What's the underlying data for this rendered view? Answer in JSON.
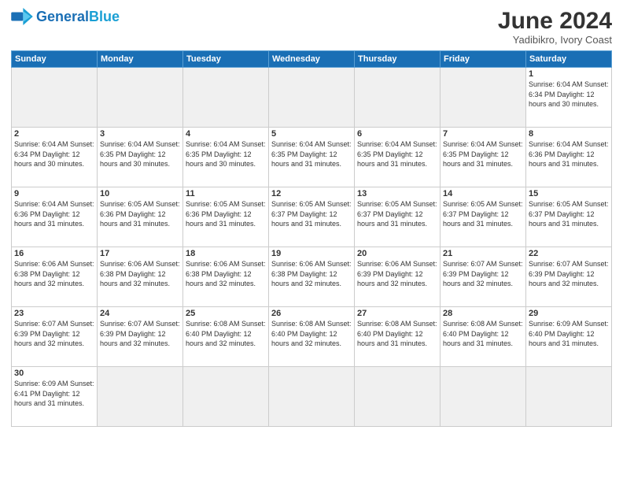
{
  "header": {
    "logo_general": "General",
    "logo_blue": "Blue",
    "month_year": "June 2024",
    "location": "Yadibikro, Ivory Coast"
  },
  "weekdays": [
    "Sunday",
    "Monday",
    "Tuesday",
    "Wednesday",
    "Thursday",
    "Friday",
    "Saturday"
  ],
  "weeks": [
    [
      {
        "day": "",
        "info": ""
      },
      {
        "day": "",
        "info": ""
      },
      {
        "day": "",
        "info": ""
      },
      {
        "day": "",
        "info": ""
      },
      {
        "day": "",
        "info": ""
      },
      {
        "day": "",
        "info": ""
      },
      {
        "day": "1",
        "info": "Sunrise: 6:04 AM\nSunset: 6:34 PM\nDaylight: 12 hours\nand 30 minutes."
      }
    ],
    [
      {
        "day": "2",
        "info": "Sunrise: 6:04 AM\nSunset: 6:34 PM\nDaylight: 12 hours\nand 30 minutes."
      },
      {
        "day": "3",
        "info": "Sunrise: 6:04 AM\nSunset: 6:35 PM\nDaylight: 12 hours\nand 30 minutes."
      },
      {
        "day": "4",
        "info": "Sunrise: 6:04 AM\nSunset: 6:35 PM\nDaylight: 12 hours\nand 30 minutes."
      },
      {
        "day": "5",
        "info": "Sunrise: 6:04 AM\nSunset: 6:35 PM\nDaylight: 12 hours\nand 31 minutes."
      },
      {
        "day": "6",
        "info": "Sunrise: 6:04 AM\nSunset: 6:35 PM\nDaylight: 12 hours\nand 31 minutes."
      },
      {
        "day": "7",
        "info": "Sunrise: 6:04 AM\nSunset: 6:35 PM\nDaylight: 12 hours\nand 31 minutes."
      },
      {
        "day": "8",
        "info": "Sunrise: 6:04 AM\nSunset: 6:36 PM\nDaylight: 12 hours\nand 31 minutes."
      }
    ],
    [
      {
        "day": "9",
        "info": "Sunrise: 6:04 AM\nSunset: 6:36 PM\nDaylight: 12 hours\nand 31 minutes."
      },
      {
        "day": "10",
        "info": "Sunrise: 6:05 AM\nSunset: 6:36 PM\nDaylight: 12 hours\nand 31 minutes."
      },
      {
        "day": "11",
        "info": "Sunrise: 6:05 AM\nSunset: 6:36 PM\nDaylight: 12 hours\nand 31 minutes."
      },
      {
        "day": "12",
        "info": "Sunrise: 6:05 AM\nSunset: 6:37 PM\nDaylight: 12 hours\nand 31 minutes."
      },
      {
        "day": "13",
        "info": "Sunrise: 6:05 AM\nSunset: 6:37 PM\nDaylight: 12 hours\nand 31 minutes."
      },
      {
        "day": "14",
        "info": "Sunrise: 6:05 AM\nSunset: 6:37 PM\nDaylight: 12 hours\nand 31 minutes."
      },
      {
        "day": "15",
        "info": "Sunrise: 6:05 AM\nSunset: 6:37 PM\nDaylight: 12 hours\nand 31 minutes."
      }
    ],
    [
      {
        "day": "16",
        "info": "Sunrise: 6:06 AM\nSunset: 6:38 PM\nDaylight: 12 hours\nand 32 minutes."
      },
      {
        "day": "17",
        "info": "Sunrise: 6:06 AM\nSunset: 6:38 PM\nDaylight: 12 hours\nand 32 minutes."
      },
      {
        "day": "18",
        "info": "Sunrise: 6:06 AM\nSunset: 6:38 PM\nDaylight: 12 hours\nand 32 minutes."
      },
      {
        "day": "19",
        "info": "Sunrise: 6:06 AM\nSunset: 6:38 PM\nDaylight: 12 hours\nand 32 minutes."
      },
      {
        "day": "20",
        "info": "Sunrise: 6:06 AM\nSunset: 6:39 PM\nDaylight: 12 hours\nand 32 minutes."
      },
      {
        "day": "21",
        "info": "Sunrise: 6:07 AM\nSunset: 6:39 PM\nDaylight: 12 hours\nand 32 minutes."
      },
      {
        "day": "22",
        "info": "Sunrise: 6:07 AM\nSunset: 6:39 PM\nDaylight: 12 hours\nand 32 minutes."
      }
    ],
    [
      {
        "day": "23",
        "info": "Sunrise: 6:07 AM\nSunset: 6:39 PM\nDaylight: 12 hours\nand 32 minutes."
      },
      {
        "day": "24",
        "info": "Sunrise: 6:07 AM\nSunset: 6:39 PM\nDaylight: 12 hours\nand 32 minutes."
      },
      {
        "day": "25",
        "info": "Sunrise: 6:08 AM\nSunset: 6:40 PM\nDaylight: 12 hours\nand 32 minutes."
      },
      {
        "day": "26",
        "info": "Sunrise: 6:08 AM\nSunset: 6:40 PM\nDaylight: 12 hours\nand 32 minutes."
      },
      {
        "day": "27",
        "info": "Sunrise: 6:08 AM\nSunset: 6:40 PM\nDaylight: 12 hours\nand 31 minutes."
      },
      {
        "day": "28",
        "info": "Sunrise: 6:08 AM\nSunset: 6:40 PM\nDaylight: 12 hours\nand 31 minutes."
      },
      {
        "day": "29",
        "info": "Sunrise: 6:09 AM\nSunset: 6:40 PM\nDaylight: 12 hours\nand 31 minutes."
      }
    ],
    [
      {
        "day": "30",
        "info": "Sunrise: 6:09 AM\nSunset: 6:41 PM\nDaylight: 12 hours\nand 31 minutes."
      },
      {
        "day": "",
        "info": ""
      },
      {
        "day": "",
        "info": ""
      },
      {
        "day": "",
        "info": ""
      },
      {
        "day": "",
        "info": ""
      },
      {
        "day": "",
        "info": ""
      },
      {
        "day": "",
        "info": ""
      }
    ]
  ]
}
